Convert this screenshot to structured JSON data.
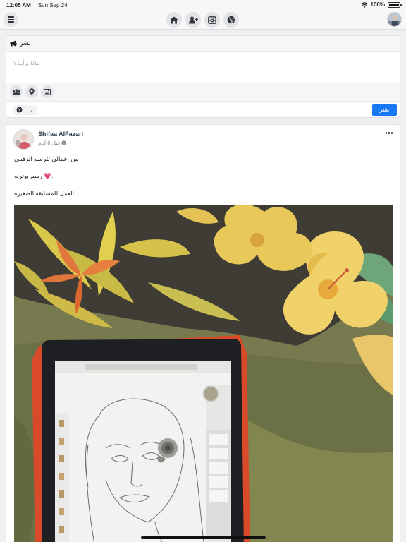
{
  "status_bar": {
    "time": "12:05 AM",
    "date": "Sun Sep 24",
    "battery": "100%"
  },
  "topbar": {
    "menu_icon": "hamburger-icon",
    "nav": [
      {
        "icon": "home-icon"
      },
      {
        "icon": "add-friend-icon"
      },
      {
        "icon": "inbox-icon"
      },
      {
        "icon": "globe-icon"
      }
    ],
    "profile_icon": "avatar"
  },
  "composer": {
    "title": "نشر",
    "title_icon": "megaphone-icon",
    "placeholder": "ماذا برأيك؟",
    "tools": [
      {
        "icon": "users-icon"
      },
      {
        "icon": "location-pin-icon"
      },
      {
        "icon": "image-icon"
      }
    ],
    "privacy_icon": "globe-icon",
    "publish_label": "نشر",
    "accent": "#1877f2"
  },
  "post": {
    "author": "Shifaa AlFazari",
    "time_ago": "قبل 6 أيام",
    "lines": [
      "من اعمالي للرسم الرقمي",
      "رسم بوتريه 💗.",
      "العمل للمسابقه الصغيره"
    ]
  }
}
